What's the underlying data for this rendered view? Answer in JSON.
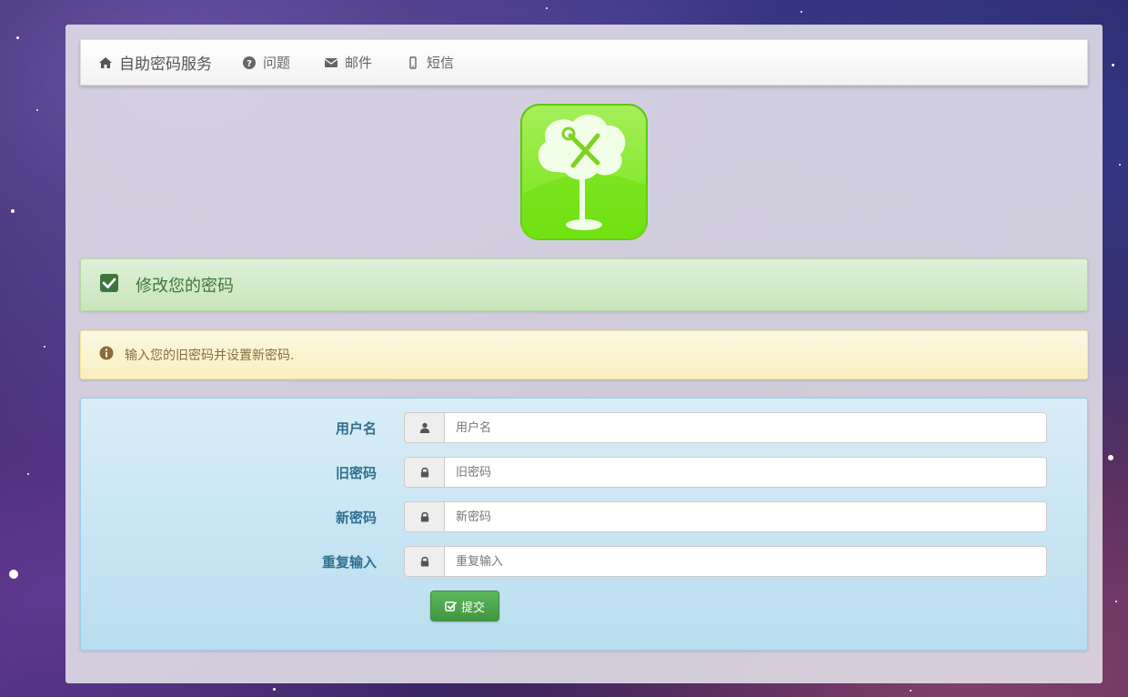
{
  "navbar": {
    "brand": {
      "icon": "home-icon",
      "label": "自助密码服务"
    },
    "items": [
      {
        "icon": "question-circle-icon",
        "label": "问题"
      },
      {
        "icon": "envelope-icon",
        "label": "邮件"
      },
      {
        "icon": "mobile-icon",
        "label": "短信"
      }
    ]
  },
  "logo": {
    "icon": "tree-wrench-logo",
    "color": "#7ed321"
  },
  "success_alert": {
    "icon": "check-square-icon",
    "title": "修改您的密码"
  },
  "warning_alert": {
    "icon": "info-circle-icon",
    "message": "输入您的旧密码并设置新密码."
  },
  "form": {
    "fields": [
      {
        "label": "用户名",
        "icon": "user-icon",
        "placeholder": "用户名",
        "value": ""
      },
      {
        "label": "旧密码",
        "icon": "lock-icon",
        "placeholder": "旧密码",
        "value": ""
      },
      {
        "label": "新密码",
        "icon": "lock-icon",
        "placeholder": "新密码",
        "value": ""
      },
      {
        "label": "重复输入",
        "icon": "lock-icon",
        "placeholder": "重复输入",
        "value": ""
      }
    ],
    "submit": {
      "icon": "check-square-o-icon",
      "label": "提交"
    }
  },
  "colors": {
    "success_text": "#3c763d",
    "warning_text": "#8a6d3b",
    "info_label": "#31708f",
    "button_green": "#5cb85c"
  }
}
